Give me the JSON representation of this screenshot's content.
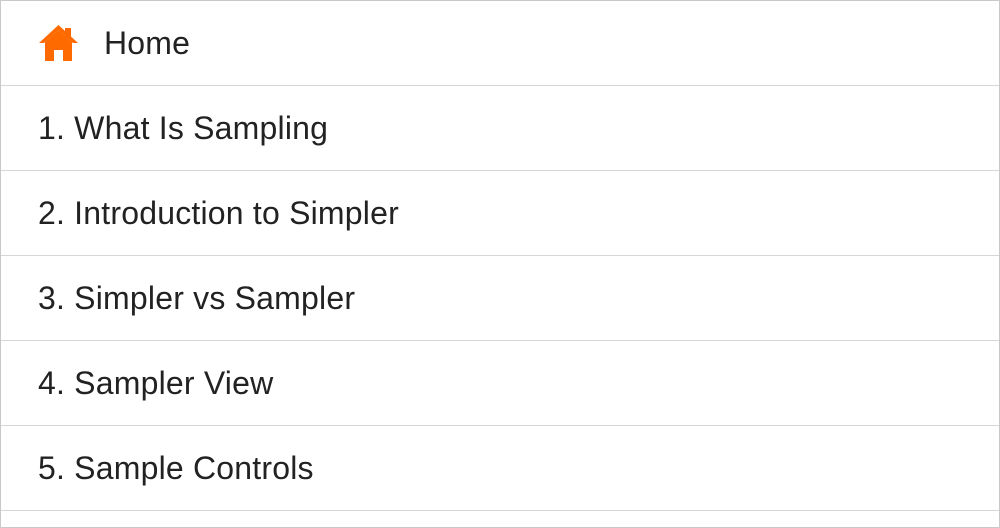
{
  "colors": {
    "accent": "#ff6a00",
    "text": "#222222",
    "divider": "#d6d6d6"
  },
  "home": {
    "icon": "home-icon",
    "label": "Home"
  },
  "items": [
    {
      "label": "1. What Is Sampling"
    },
    {
      "label": "2. Introduction to Simpler"
    },
    {
      "label": "3. Simpler vs Sampler"
    },
    {
      "label": "4. Sampler View"
    },
    {
      "label": "5. Sample Controls"
    }
  ]
}
